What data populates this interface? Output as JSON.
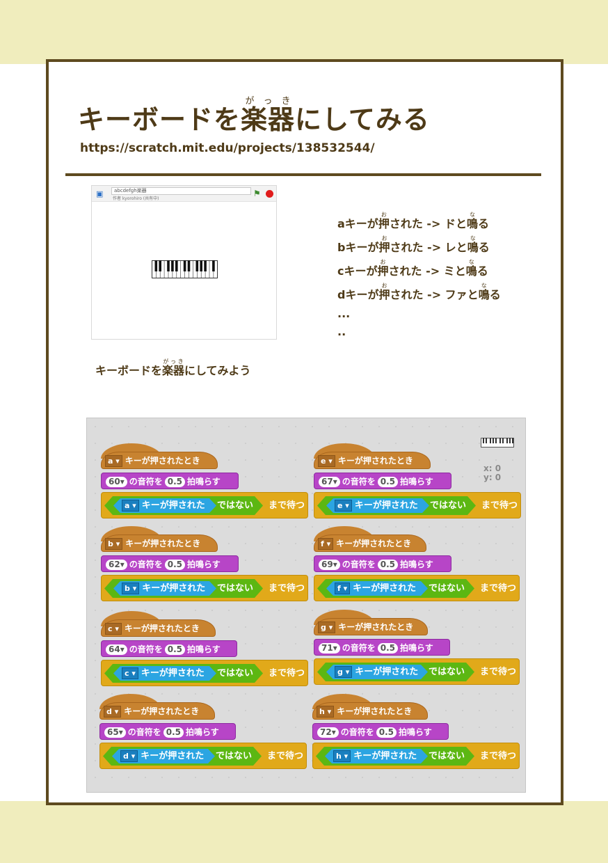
{
  "header": {
    "title_before": "キーボードを",
    "title_ruby_base": "楽器",
    "title_ruby_reading": "がっき",
    "title_after": "にしてみる",
    "url": "https://scratch.mit.edu/projects/138532544/"
  },
  "stage": {
    "project_name": "abcdefgh楽器",
    "author": "作者 kyorohiro (共有中)",
    "flag_icon": "green-flag-icon",
    "stop_icon": "stop-icon"
  },
  "notes": {
    "ruby_press": "お",
    "ruby_sound": "な",
    "lines": [
      {
        "pre": "aキーが",
        "press": "押",
        "mid": "された -> ドと",
        "sound": "鳴",
        "post": "る"
      },
      {
        "pre": "bキーが",
        "press": "押",
        "mid": "された -> レと",
        "sound": "鳴",
        "post": "る"
      },
      {
        "pre": "cキーが",
        "press": "押",
        "mid": "された -> ミと",
        "sound": "鳴",
        "post": "る"
      },
      {
        "pre": "dキーが",
        "press": "押",
        "mid": "された -> ファと",
        "sound": "鳴",
        "post": "る"
      }
    ],
    "ellipsis1": "...",
    "ellipsis2": ".."
  },
  "caption": {
    "before": "キーボードを",
    "ruby_base": "楽器",
    "ruby_reading": "がっき",
    "after": "にしてみよう"
  },
  "code_area": {
    "x_label": "x: 0",
    "y_label": "y: 0",
    "hat_text": "キーが押されたとき",
    "play_mid": "の音符を",
    "beats": "0.5",
    "play_end": "拍鳴らす",
    "key_pressed_text": "キーが押された",
    "not_text": "ではない",
    "wait_text": "まで待つ",
    "scripts": [
      {
        "key": "a",
        "note": "60"
      },
      {
        "key": "e",
        "note": "67"
      },
      {
        "key": "b",
        "note": "62"
      },
      {
        "key": "f",
        "note": "69"
      },
      {
        "key": "c",
        "note": "64"
      },
      {
        "key": "g",
        "note": "71"
      },
      {
        "key": "d",
        "note": "65"
      },
      {
        "key": "h",
        "note": "72"
      }
    ]
  },
  "colors": {
    "band": "#f0edbd",
    "frame": "#5e4a1f",
    "text": "#4e3a17",
    "events": "#c88330",
    "sound": "#b745c7",
    "control": "#e1a91a",
    "operators": "#5cb712",
    "sensing": "#2ca5e2"
  }
}
